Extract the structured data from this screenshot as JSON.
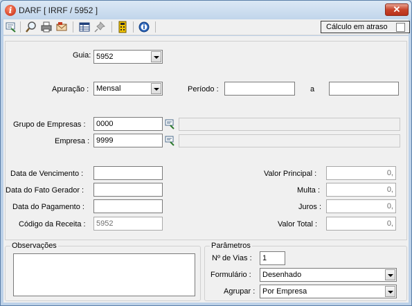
{
  "window": {
    "title": "DARF [ IRRF / 5952 ]",
    "close_glyph": "✕"
  },
  "toolbar": {
    "icons": [
      "lookup-icon",
      "search-icon",
      "print-icon",
      "email-icon",
      "table-icon",
      "pin-icon",
      "calculator-icon",
      "info-icon"
    ],
    "calculo_em_atraso_label": "Cálculo em atraso",
    "calculo_em_atraso_checked": false
  },
  "form": {
    "guia": {
      "label": "Guia:",
      "value": "5952"
    },
    "apuracao": {
      "label": "Apuração :",
      "value": "Mensal"
    },
    "periodo": {
      "label": "Período  :",
      "from": "",
      "sep": "a",
      "to": ""
    },
    "grupo_empresas": {
      "label": "Grupo de Empresas :",
      "value": "0000",
      "description": ""
    },
    "empresa": {
      "label": "Empresa :",
      "value": "9999",
      "description": ""
    },
    "data_vencimento": {
      "label": "Data de Vencimento :",
      "value": ""
    },
    "data_fato_gerador": {
      "label": "Data do Fato Gerador :",
      "value": ""
    },
    "data_pagamento": {
      "label": "Data do Pagamento :",
      "value": ""
    },
    "codigo_receita": {
      "label": "Código da Receita :",
      "value": "5952"
    },
    "valor_principal": {
      "label": "Valor Principal :",
      "value": "0,"
    },
    "multa": {
      "label": "Multa :",
      "value": "0,"
    },
    "juros": {
      "label": "Juros :",
      "value": "0,"
    },
    "valor_total": {
      "label": "Valor Total :",
      "value": "0,"
    }
  },
  "observacoes": {
    "legend": "Observações",
    "value": ""
  },
  "parametros": {
    "legend": "Parâmetros",
    "vias": {
      "label": "Nº de Vias :",
      "value": "1"
    },
    "formulario": {
      "label": "Formulário :",
      "value": "Desenhado"
    },
    "agrupar": {
      "label": "Agrupar :",
      "value": "Por Empresa"
    }
  },
  "colors": {
    "window_frame": "#bcd1e8",
    "close_button": "#c7432a",
    "panel_bg": "#f0f0f0"
  }
}
